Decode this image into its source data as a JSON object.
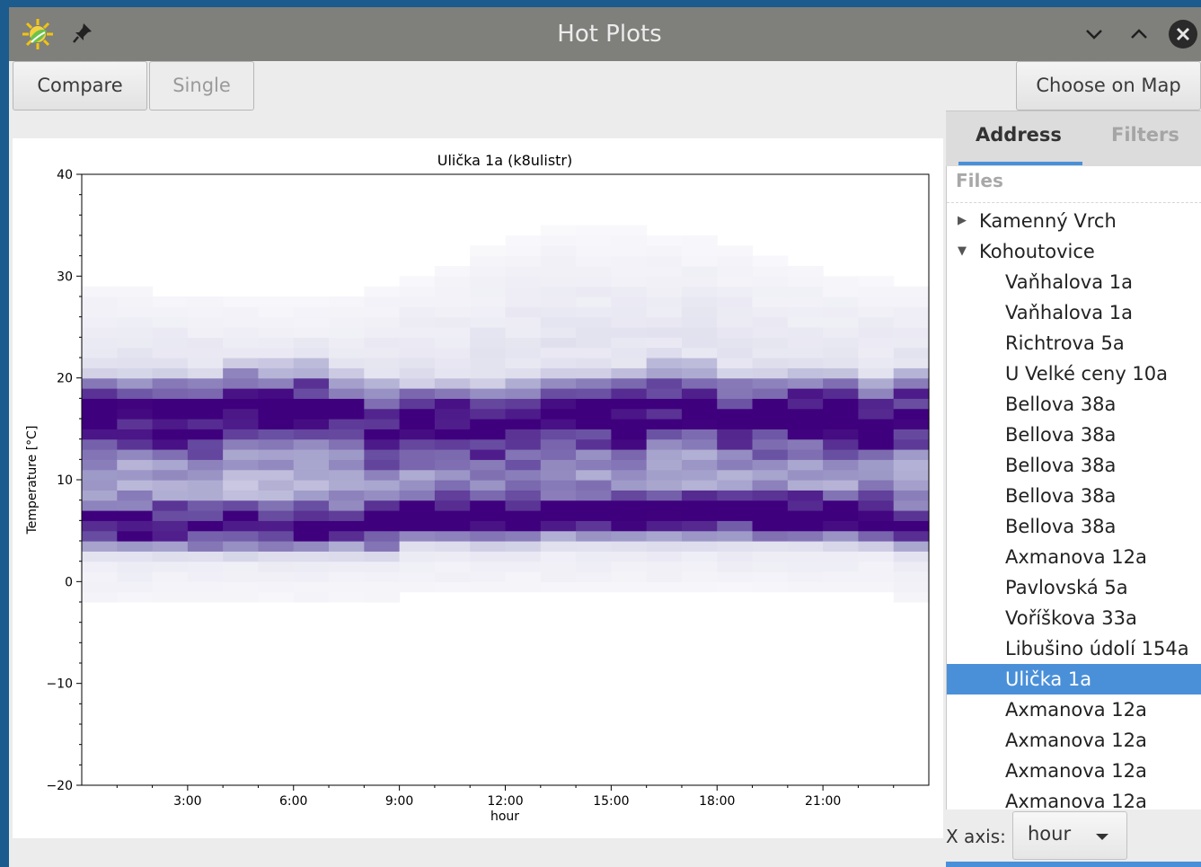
{
  "window": {
    "title": "Hot Plots"
  },
  "toolbar": {
    "compare_label": "Compare",
    "single_label": "Single",
    "choose_on_map_label": "Choose on Map"
  },
  "sidebar": {
    "tabs": [
      {
        "label": "Address"
      },
      {
        "label": "Filters"
      }
    ],
    "tree_header": "Files",
    "items": [
      {
        "label": "Kamenný Vrch",
        "level": 0,
        "expander": "collapsed"
      },
      {
        "label": "Kohoutovice",
        "level": 0,
        "expander": "expanded"
      },
      {
        "label": "Vaňhalova 1a",
        "level": 1
      },
      {
        "label": "Vaňhalova 1a",
        "level": 1
      },
      {
        "label": "Richtrova 5a",
        "level": 1
      },
      {
        "label": "U Velké ceny 10a",
        "level": 1
      },
      {
        "label": "Bellova 38a",
        "level": 1
      },
      {
        "label": "Bellova 38a",
        "level": 1
      },
      {
        "label": "Bellova 38a",
        "level": 1
      },
      {
        "label": "Bellova 38a",
        "level": 1
      },
      {
        "label": "Bellova 38a",
        "level": 1
      },
      {
        "label": "Axmanova 12a",
        "level": 1
      },
      {
        "label": "Pavlovská 5a",
        "level": 1
      },
      {
        "label": "Voříškova 33a",
        "level": 1
      },
      {
        "label": "Libušino údolí 154a",
        "level": 1
      },
      {
        "label": "Ulička 1a",
        "level": 1,
        "selected": true
      },
      {
        "label": "Axmanova 12a",
        "level": 1
      },
      {
        "label": "Axmanova 12a",
        "level": 1
      },
      {
        "label": "Axmanova 12a",
        "level": 1
      },
      {
        "label": "Axmanova 12a",
        "level": 1
      }
    ],
    "x_axis_label": "X axis:",
    "x_axis_value": "hour"
  },
  "colors": {
    "selection": "#4a90d9",
    "titlebar": "#7f7f7b",
    "heatmap_max": "#3f007d"
  },
  "chart_data": {
    "type": "heatmap",
    "title": "Ulička 1a (k8ulistr)",
    "xlabel": "hour",
    "ylabel": "Temperature [°C]",
    "xlim": [
      0,
      24
    ],
    "ylim": [
      -20,
      40
    ],
    "x_ticks": [
      3,
      6,
      9,
      12,
      15,
      18,
      21
    ],
    "x_tick_labels": [
      "3:00",
      "6:00",
      "9:00",
      "12:00",
      "15:00",
      "18:00",
      "21:00"
    ],
    "y_ticks": [
      -20,
      -10,
      0,
      10,
      20,
      30,
      40
    ],
    "y_tick_labels": [
      "−20",
      "−10",
      "0",
      "10",
      "20",
      "30",
      "40"
    ],
    "colormap": "Purples",
    "bin_width_hours": 1,
    "bin_height_celsius": 1,
    "hourly_main_band": {
      "hour": [
        0,
        1,
        2,
        3,
        4,
        5,
        6,
        7,
        8,
        9,
        10,
        11,
        12,
        13,
        14,
        15,
        16,
        17,
        18,
        19,
        20,
        21,
        22,
        23
      ],
      "mode_low_c": [
        5,
        5,
        5,
        5,
        5,
        5,
        5,
        5,
        5,
        6,
        6,
        6,
        6,
        6,
        6,
        6,
        6,
        6,
        6,
        6,
        6,
        6,
        6,
        5
      ],
      "mode_high_c": [
        16,
        16,
        16,
        16,
        17,
        17,
        17,
        16,
        15,
        15,
        15,
        15,
        15,
        16,
        16,
        16,
        17,
        17,
        16,
        16,
        16,
        16,
        15,
        16
      ],
      "upper_extent_c": [
        31,
        31,
        30,
        30,
        29,
        29,
        29,
        30,
        31,
        32,
        33,
        35,
        36,
        37,
        37,
        37,
        36,
        36,
        35,
        34,
        33,
        32,
        32,
        31
      ]
    }
  }
}
